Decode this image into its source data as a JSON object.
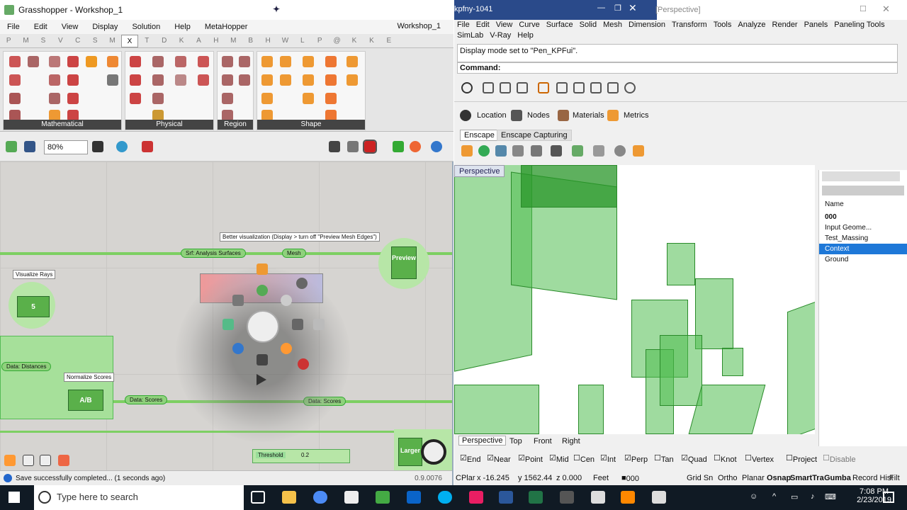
{
  "gh": {
    "title": "Grasshopper - Workshop_1",
    "menu": [
      "File",
      "Edit",
      "View",
      "Display",
      "Solution",
      "Help",
      "MetaHopper"
    ],
    "doc": "Workshop_1",
    "tabs": [
      "P",
      "M",
      "S",
      "V",
      "C",
      "S",
      "M",
      "X",
      "T",
      "D",
      "K",
      "A",
      "H",
      "M",
      "B",
      "H",
      "W",
      "L",
      "P",
      "@",
      "K",
      "K",
      "E"
    ],
    "groups": [
      "Mathematical",
      "Physical",
      "Region",
      "Shape"
    ],
    "zoom": "80%",
    "note1": "Better visualization (Display > turn off \"Preview Mesh Edges\")",
    "visualize_rays": "Visualize Rays",
    "normalize": "Normalize Scores",
    "p_srf": "Srf: Analysis Surfaces",
    "p_mesh": "Mesh",
    "p_dist": "Data: Distances",
    "p_scores": "Data: Scores",
    "p_scores2": "Data: Scores",
    "threshold": "Threshold",
    "threshold_val": "0.2",
    "preview": "Preview",
    "larger": "Larger",
    "status": "Save successfully completed... (1 seconds ago)",
    "version": "0.9.0076"
  },
  "rh": {
    "title": "[Perspective]",
    "kpfny": "kpfny-1041",
    "menu": [
      "File",
      "Edit",
      "View",
      "Curve",
      "Surface",
      "Solid",
      "Mesh",
      "Dimension",
      "Transform",
      "Tools",
      "Analyze",
      "Render",
      "Panels",
      "Paneling Tools",
      "SimLab",
      "V-Ray",
      "Help"
    ],
    "history": "Display mode set to \"Pen_KPFui\".",
    "command": "Command:",
    "location": "Location",
    "nodes": "Nodes",
    "materials": "Materials",
    "metrics": "Metrics",
    "tab_enscape": "Enscape",
    "tab_capturing": "Enscape Capturing",
    "viewport": "Perspective",
    "layers_header": "Name",
    "layers": [
      "000",
      "Input Geome...",
      "Test_Massing",
      "Context",
      "Ground"
    ],
    "views": [
      "Perspective",
      "Top",
      "Front",
      "Right"
    ],
    "osnaps": [
      "End",
      "Near",
      "Point",
      "Mid",
      "Cen",
      "Int",
      "Perp",
      "Tan",
      "Quad",
      "Knot",
      "Vertex",
      "Project",
      "Disable"
    ],
    "status": {
      "cplane": "CPlar",
      "x": "x -16.245",
      "y": "y 1562.44",
      "z": "z 0.000",
      "units": "Feet",
      "layer": "000",
      "modes": [
        "Grid Sn",
        "Ortho",
        "Planar",
        "Osnap",
        "SmartTra",
        "Gumba",
        "Record Hist",
        "Filt"
      ]
    }
  },
  "taskbar": {
    "search": "Type here to search",
    "time": "7:08 PM",
    "date": "2/23/2019"
  }
}
